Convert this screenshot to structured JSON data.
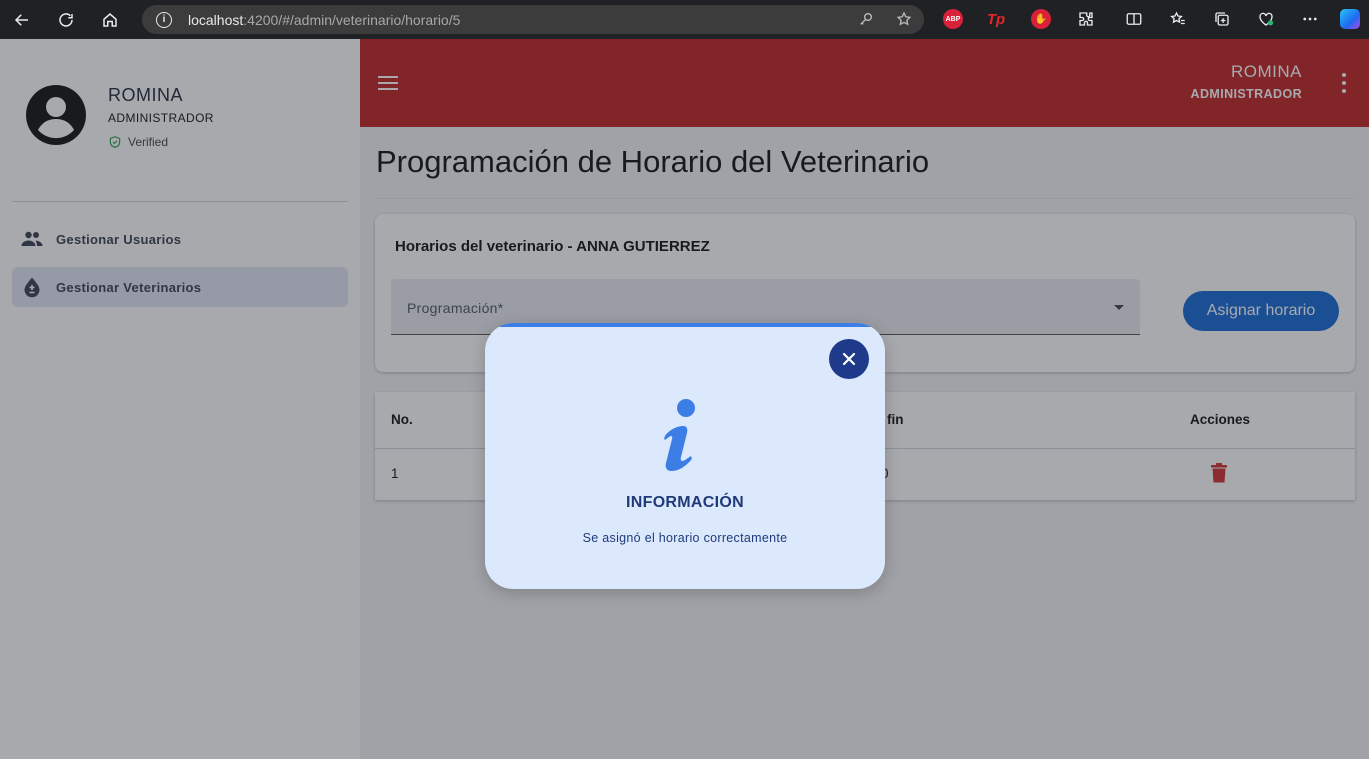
{
  "browser": {
    "url_host": "localhost",
    "url_path": ":4200/#/admin/veterinario/horario/5"
  },
  "sidebar": {
    "user_name": "ROMINA",
    "user_role": "ADMINISTRADOR",
    "verified_label": "Verified",
    "items": [
      {
        "label": "Gestionar Usuarios",
        "icon": "people-icon",
        "active": false
      },
      {
        "label": "Gestionar Veterinarios",
        "icon": "drop-plus-minus-icon",
        "active": true
      }
    ]
  },
  "topbar": {
    "user_name": "ROMINA",
    "user_role": "ADMINISTRADOR"
  },
  "page": {
    "title": "Programación de Horario del Veterinario"
  },
  "card": {
    "title": "Horarios del veterinario - ANNA GUTIERREZ",
    "select_label": "Programación*",
    "assign_button": "Asignar horario"
  },
  "table": {
    "headers": {
      "no": "No.",
      "end": "fin",
      "actions": "Acciones"
    },
    "rows": [
      {
        "no": "1",
        "end": "0"
      }
    ]
  },
  "modal": {
    "title": "INFORMACIÓN",
    "message": "Se asignó el horario correctamente"
  },
  "colors": {
    "topbar": "#c02424",
    "primary_button": "#1769d4",
    "modal_bg": "#dce9fc",
    "modal_accent": "#1f3a8a",
    "delete": "#d32f2f"
  }
}
